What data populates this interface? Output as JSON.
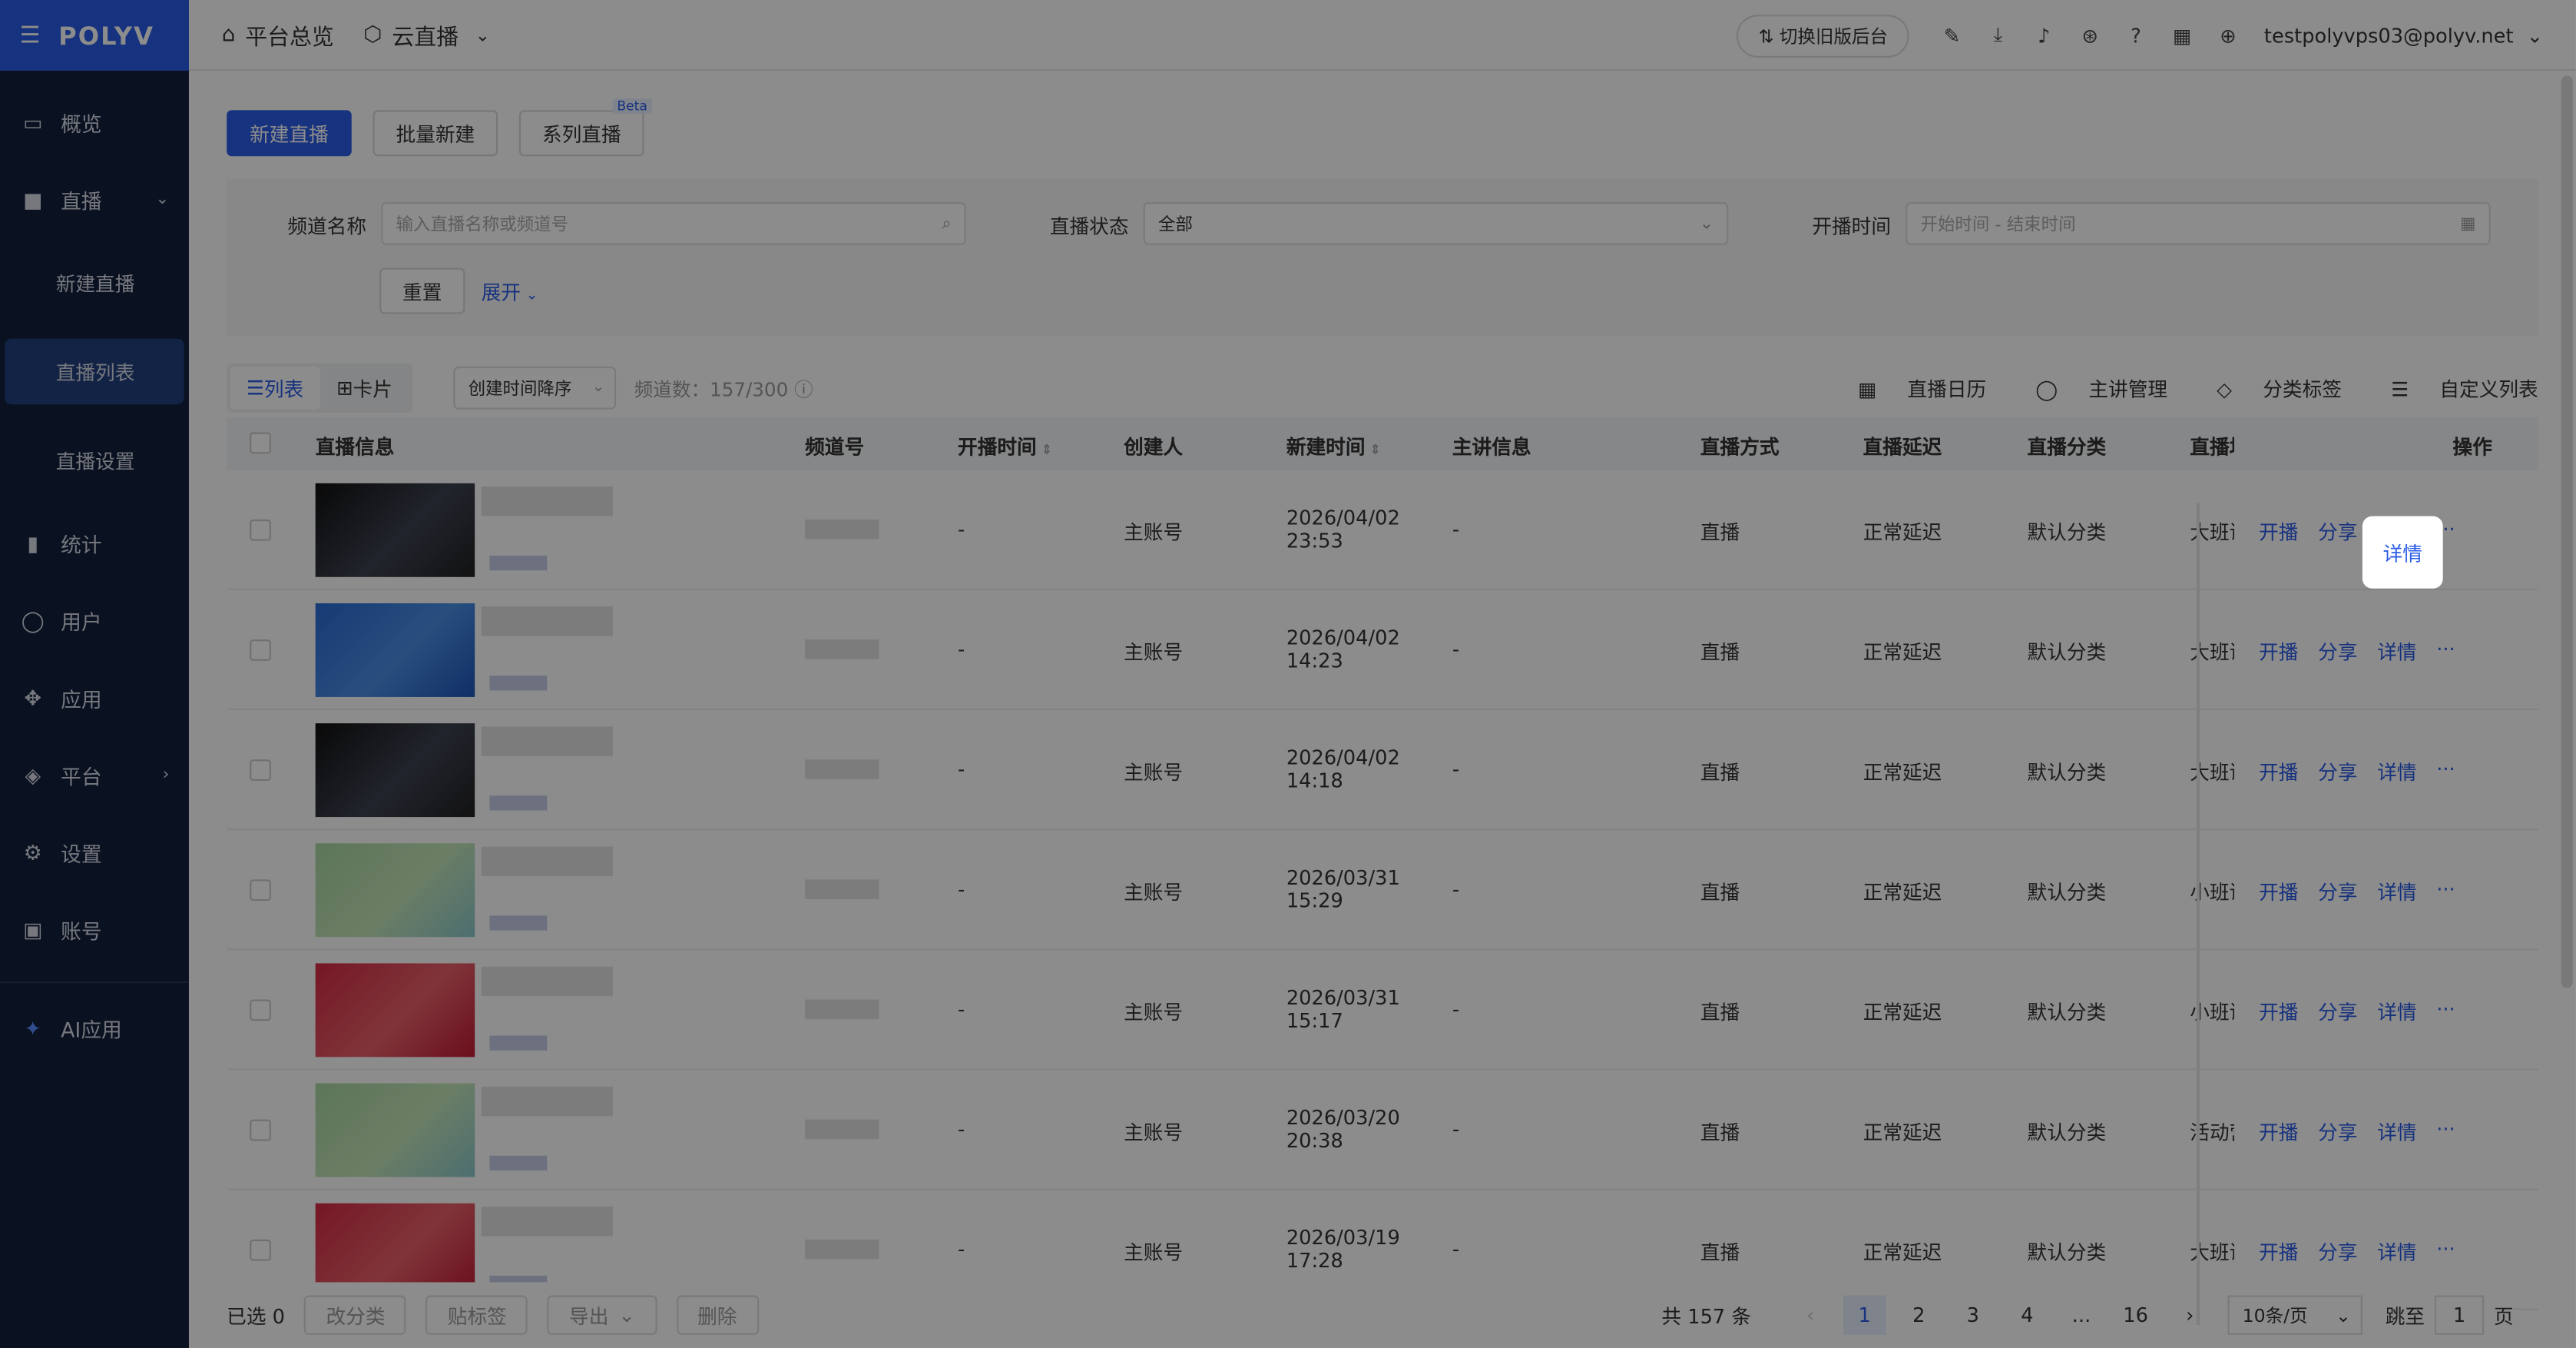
{
  "sidebar": {
    "logo": "POLYV",
    "items": [
      {
        "label": "概览",
        "icon": "monitor-icon"
      },
      {
        "label": "直播",
        "icon": "video-icon"
      },
      {
        "label": "统计",
        "icon": "bar-chart-icon"
      },
      {
        "label": "用户",
        "icon": "user-icon"
      },
      {
        "label": "应用",
        "icon": "apps-icon"
      },
      {
        "label": "平台",
        "icon": "layers-icon"
      },
      {
        "label": "设置",
        "icon": "gear-icon"
      },
      {
        "label": "账号",
        "icon": "id-card-icon"
      },
      {
        "label": "AI应用",
        "icon": "sparkle-icon"
      }
    ],
    "sub": [
      "新建直播",
      "直播列表",
      "直播设置"
    ]
  },
  "topbar": {
    "overview": "平台总览",
    "product": "云直播",
    "switch": "切换旧版后台",
    "user": "testpolyvps03@polyv.net"
  },
  "actions": {
    "create": "新建直播",
    "batch": "批量新建",
    "series": "系列直播",
    "beta": "Beta"
  },
  "filter": {
    "name_label": "频道名称",
    "name_placeholder": "输入直播名称或频道号",
    "status_label": "直播状态",
    "status_value": "全部",
    "time_label": "开播时间",
    "time_placeholder": "开始时间 - 结束时间",
    "reset": "重置",
    "expand": "展开"
  },
  "toolbar": {
    "list": "列表",
    "card": "卡片",
    "sort": "创建时间降序",
    "count": "频道数：157/300",
    "calendar": "直播日历",
    "speaker": "主讲管理",
    "tags": "分类标签",
    "custom": "自定义列表"
  },
  "table": {
    "headers": [
      "直播信息",
      "频道号",
      "开播时间",
      "创建人",
      "新建时间",
      "主讲信息",
      "直播方式",
      "直播延迟",
      "直播分类",
      "直播场",
      "操作"
    ],
    "rows": [
      {
        "start": "-",
        "creator": "主账号",
        "date": "2026/04/02",
        "time": "23:53",
        "speaker": "-",
        "mode": "直播",
        "delay": "正常延迟",
        "cat": "默认分类",
        "scene": "大班课",
        "thumb": "dark"
      },
      {
        "start": "-",
        "creator": "主账号",
        "date": "2026/04/02",
        "time": "14:23",
        "speaker": "-",
        "mode": "直播",
        "delay": "正常延迟",
        "cat": "默认分类",
        "scene": "大班课",
        "thumb": "blue"
      },
      {
        "start": "-",
        "creator": "主账号",
        "date": "2026/04/02",
        "time": "14:18",
        "speaker": "-",
        "mode": "直播",
        "delay": "正常延迟",
        "cat": "默认分类",
        "scene": "大班课",
        "thumb": "dark"
      },
      {
        "start": "-",
        "creator": "主账号",
        "date": "2026/03/31",
        "time": "15:29",
        "speaker": "-",
        "mode": "直播",
        "delay": "正常延迟",
        "cat": "默认分类",
        "scene": "小班课",
        "thumb": "green"
      },
      {
        "start": "-",
        "creator": "主账号",
        "date": "2026/03/31",
        "time": "15:17",
        "speaker": "-",
        "mode": "直播",
        "delay": "正常延迟",
        "cat": "默认分类",
        "scene": "小班课",
        "thumb": "red"
      },
      {
        "start": "-",
        "creator": "主账号",
        "date": "2026/03/20",
        "time": "20:38",
        "speaker": "-",
        "mode": "直播",
        "delay": "正常延迟",
        "cat": "默认分类",
        "scene": "活动营",
        "thumb": "green"
      },
      {
        "start": "-",
        "creator": "主账号",
        "date": "2026/03/19",
        "time": "17:28",
        "speaker": "-",
        "mode": "直播",
        "delay": "正常延迟",
        "cat": "默认分类",
        "scene": "大班课",
        "thumb": "red"
      }
    ],
    "ops": [
      "开播",
      "分享",
      "详情",
      "···"
    ]
  },
  "footer": {
    "selected": "已选 0",
    "recat": "改分类",
    "tag": "贴标签",
    "export": "导出",
    "delete": "删除",
    "total": "共 157 条",
    "pages": [
      "1",
      "2",
      "3",
      "4",
      "...",
      "16"
    ],
    "per_page": "10条/页",
    "jump": "跳至",
    "jump_val": "1",
    "page_unit": "页"
  }
}
